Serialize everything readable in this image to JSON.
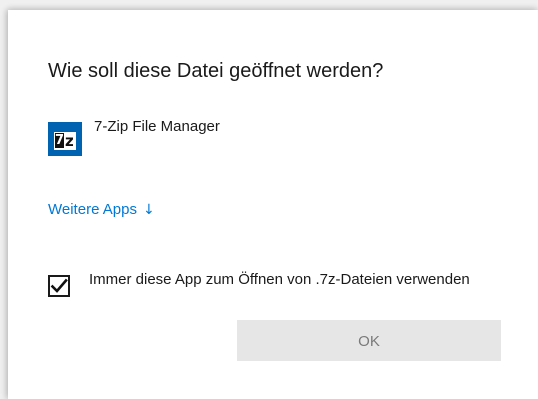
{
  "dialog": {
    "title": "Wie soll diese Datei geöffnet werden?",
    "app": {
      "name": "7-Zip File Manager",
      "icon": "7z-app-icon",
      "icon_text_7": "7",
      "icon_text_z": "z"
    },
    "more_apps": {
      "label": "Weitere Apps",
      "arrow": "↓"
    },
    "always_use": {
      "label": "Immer diese App zum Öffnen von .7z-Dateien verwenden",
      "checked": true
    },
    "ok_label": "OK"
  },
  "colors": {
    "link": "#0078d7",
    "icon_bg": "#0063b1",
    "button_disabled_bg": "#e6e6e6",
    "button_disabled_text": "#7a7a7a"
  }
}
